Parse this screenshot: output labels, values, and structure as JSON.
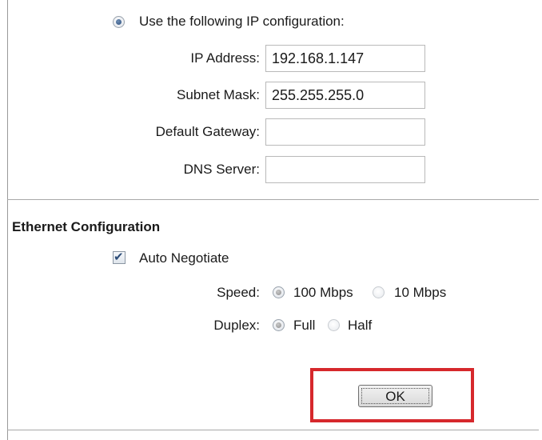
{
  "ip_config": {
    "option_label": "Use the following IP configuration:",
    "option_selected": true,
    "fields": [
      {
        "label": "IP Address:",
        "value": "192.168.1.147"
      },
      {
        "label": "Subnet Mask:",
        "value": "255.255.255.0"
      },
      {
        "label": "Default Gateway:",
        "value": ""
      },
      {
        "label": "DNS Server:",
        "value": ""
      }
    ]
  },
  "ethernet": {
    "title": "Ethernet Configuration",
    "auto_negotiate_label": "Auto Negotiate",
    "auto_negotiate_checked": true,
    "speed": {
      "label": "Speed:",
      "options": [
        "100 Mbps",
        "10 Mbps"
      ],
      "selected": "100 Mbps"
    },
    "duplex": {
      "label": "Duplex:",
      "options": [
        "Full",
        "Half"
      ],
      "selected": "Full"
    }
  },
  "actions": {
    "ok_label": "OK",
    "highlight_color": "#d6282c"
  }
}
